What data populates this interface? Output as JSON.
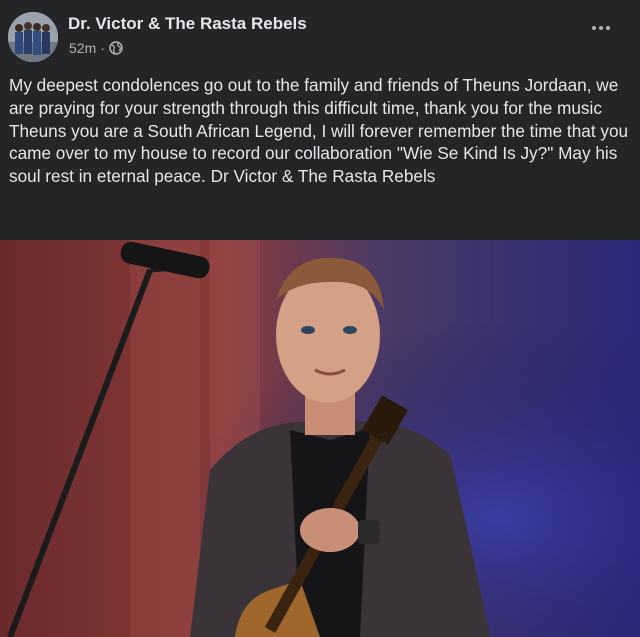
{
  "post": {
    "author": "Dr. Victor & The Rasta Rebels",
    "timestamp": "52m",
    "separator": "·",
    "privacy_icon": "globe-icon",
    "more_icon": "more-options-icon",
    "text": "My deepest condolences go out to the family and friends of Theuns Jordaan, we are praying for your strength through this difficult time, thank you for the music Theuns you are a South African Legend, I will forever remember the time that you came over to my house to record our collaboration \"Wie Se Kind Is Jy?\" May his soul rest in eternal peace. Dr Victor & The Rasta Rebels"
  },
  "colors": {
    "background": "#242526",
    "text_primary": "#e4e6eb",
    "text_secondary": "#b0b3b8"
  }
}
